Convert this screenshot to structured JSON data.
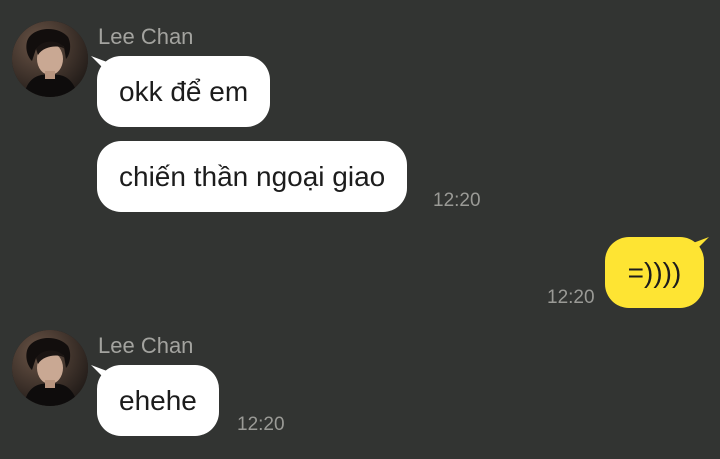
{
  "theme": {
    "background": "#323432",
    "incoming_bubble": "#ffffff",
    "outgoing_bubble": "#fee433",
    "name_color": "#a3a39f",
    "time_color": "#9a9a96"
  },
  "messages": [
    {
      "group": "incoming",
      "sender": "Lee Chan",
      "avatar_icon": "profile-photo-avatar",
      "bubbles": [
        "okk để em",
        "chiến thần ngoại giao"
      ],
      "time": "12:20"
    },
    {
      "group": "outgoing",
      "bubbles": [
        "=))))"
      ],
      "time": "12:20"
    },
    {
      "group": "incoming",
      "sender": "Lee Chan",
      "avatar_icon": "profile-photo-avatar",
      "bubbles": [
        "ehehe"
      ],
      "time": "12:20"
    }
  ]
}
